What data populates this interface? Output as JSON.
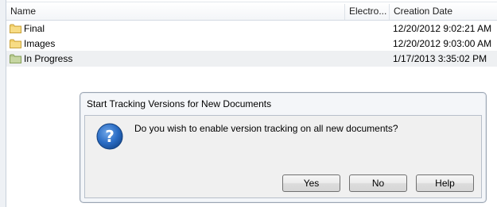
{
  "list": {
    "columns": {
      "name": "Name",
      "electro": "Electro...",
      "creation_date": "Creation Date"
    },
    "rows": [
      {
        "name": "Final",
        "date": "12/20/2012 9:02:21 AM",
        "icon": "folder-icon",
        "icon_color": "#f2d06b",
        "selected": false
      },
      {
        "name": "Images",
        "date": "12/20/2012 9:03:00 AM",
        "icon": "folder-icon",
        "icon_color": "#f2d06b",
        "selected": false
      },
      {
        "name": "In Progress",
        "date": "1/17/2013 3:35:02 PM",
        "icon": "folder-icon",
        "icon_color": "#b7c98f",
        "selected": true
      }
    ]
  },
  "dialog": {
    "title": "Start Tracking Versions for New Documents",
    "message": "Do you wish to enable version tracking on all new documents?",
    "icon": "question-icon",
    "buttons": {
      "yes": "Yes",
      "no": "No",
      "help": "Help"
    }
  },
  "colors": {
    "selected_row": "#eef0f2",
    "question_icon": "#1f5fb0"
  }
}
